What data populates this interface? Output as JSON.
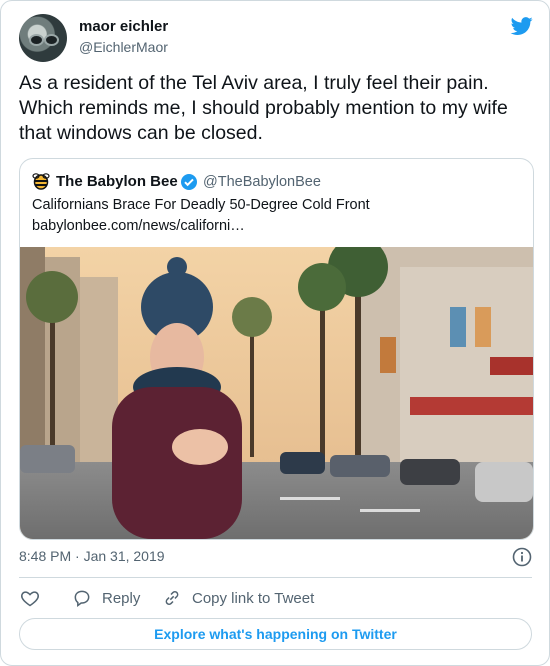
{
  "author": {
    "name": "maor eichler",
    "handle": "@EichlerMaor",
    "avatar_icon": "user-avatar"
  },
  "brand": {
    "icon": "twitter-bird-icon",
    "color": "#1d9bf0"
  },
  "tweet": {
    "text": "As a resident of the Tel Aviv area, I truly feel their pain.\nWhich reminds me, I should probably mention to my wife\nthat windows can be closed.",
    "timestamp": "8:48 PM · Jan 31, 2019"
  },
  "quoted": {
    "name": "The Babylon Bee",
    "handle": "@TheBabylonBee",
    "verified": true,
    "headline": "Californians Brace For Deadly 50-Degree Cold Front",
    "link": "babylonbee.com/news/californi…",
    "image_description_icon": "article-photo"
  },
  "actions": {
    "like_icon": "heart-icon",
    "reply_label": "Reply",
    "copy_label": "Copy link to Tweet"
  },
  "explore_label": "Explore what's happening on Twitter",
  "colors": {
    "text": "#0f1419",
    "muted": "#536471",
    "border": "#cfd9de",
    "accent": "#1d9bf0"
  }
}
